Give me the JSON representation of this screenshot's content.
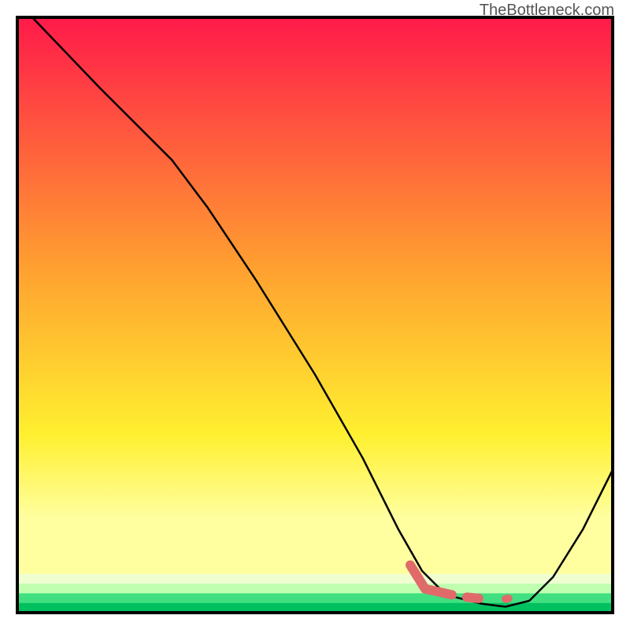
{
  "watermark": "TheBottleneck.com",
  "chart_data": {
    "type": "line",
    "title": "",
    "xlabel": "",
    "ylabel": "",
    "xlim": [
      0,
      100
    ],
    "ylim": [
      0,
      100
    ],
    "grid": false,
    "legend": false,
    "background": {
      "type": "vertical-gradient-with-bottom-bands",
      "gradient_stops": [
        {
          "pos": 0.0,
          "color": "#ff1a4a"
        },
        {
          "pos": 0.45,
          "color": "#ffa030"
        },
        {
          "pos": 0.75,
          "color": "#fff030"
        },
        {
          "pos": 0.9,
          "color": "#ffffa0"
        }
      ],
      "bottom_bands": [
        {
          "color": "#f0ffd0"
        },
        {
          "color": "#c0ffb0"
        },
        {
          "color": "#40e080"
        },
        {
          "color": "#00c060"
        }
      ]
    },
    "series": [
      {
        "name": "curve",
        "stroke": "#000000",
        "stroke_width": 2.5,
        "points": [
          {
            "x": 2.5,
            "y": 100.0
          },
          {
            "x": 14.0,
            "y": 88.0
          },
          {
            "x": 26.0,
            "y": 76.0
          },
          {
            "x": 32.0,
            "y": 68.0
          },
          {
            "x": 40.0,
            "y": 56.0
          },
          {
            "x": 50.0,
            "y": 40.0
          },
          {
            "x": 58.0,
            "y": 26.0
          },
          {
            "x": 64.0,
            "y": 14.0
          },
          {
            "x": 68.0,
            "y": 7.0
          },
          {
            "x": 72.0,
            "y": 3.0
          },
          {
            "x": 78.0,
            "y": 1.5
          },
          {
            "x": 82.0,
            "y": 1.0
          },
          {
            "x": 86.0,
            "y": 2.0
          },
          {
            "x": 90.0,
            "y": 6.0
          },
          {
            "x": 95.0,
            "y": 14.0
          },
          {
            "x": 100.0,
            "y": 24.0
          }
        ]
      },
      {
        "name": "highlight-segment",
        "stroke": "#e06a6a",
        "stroke_width": 12,
        "linecap": "round",
        "points": [
          {
            "x": 66.0,
            "y": 8.0
          },
          {
            "x": 68.5,
            "y": 4.0
          },
          {
            "x": 73.0,
            "y": 3.0
          }
        ]
      },
      {
        "name": "highlight-dot-1",
        "stroke": "#e06a6a",
        "stroke_width": 12,
        "linecap": "round",
        "points": [
          {
            "x": 75.5,
            "y": 2.6
          },
          {
            "x": 77.5,
            "y": 2.4
          }
        ]
      },
      {
        "name": "highlight-dot-2",
        "stroke": "#e06a6a",
        "stroke_width": 10,
        "linecap": "round",
        "points": [
          {
            "x": 82.0,
            "y": 2.3
          },
          {
            "x": 82.5,
            "y": 2.4
          }
        ]
      }
    ],
    "frame": {
      "stroke": "#000000",
      "stroke_width": 4
    }
  }
}
